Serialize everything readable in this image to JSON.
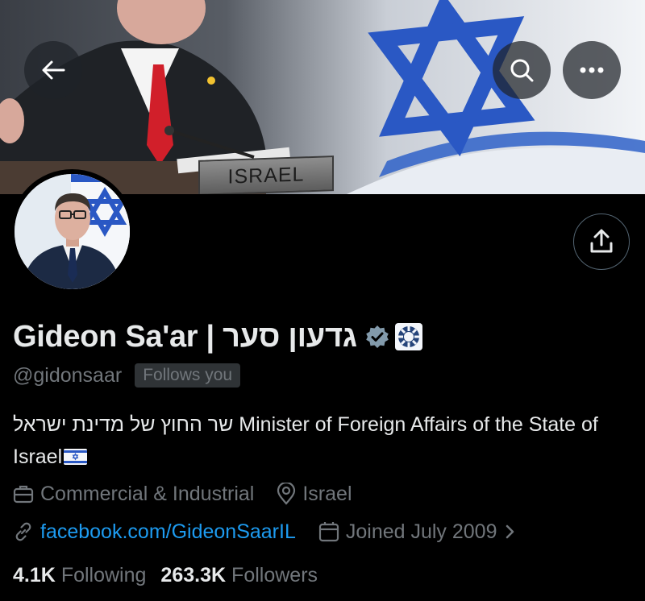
{
  "banner": {
    "nameplate_text": "ISRAEL"
  },
  "header": {
    "back_icon": "arrow-left-icon",
    "search_icon": "search-icon",
    "more_icon": "more-horizontal-icon"
  },
  "profile": {
    "display_name": "Gideon Sa'ar | גדעון סער",
    "handle": "@gidonsaar",
    "follows_you": "Follows you",
    "bio": "שר החוץ של מדינת ישראל Minister of Foreign Affairs of the State of Israel",
    "meta": {
      "category": "Commercial & Industrial",
      "location": "Israel",
      "website": "facebook.com/GideonSaarIL",
      "joined": "Joined July 2009"
    },
    "stats": {
      "following_count": "4.1K",
      "following_label": "Following",
      "followers_count": "263.3K",
      "followers_label": "Followers"
    }
  },
  "colors": {
    "background": "#000000",
    "text_primary": "#e7e9ea",
    "text_secondary": "#71767b",
    "link": "#1d9bf0",
    "verified_badge": "#829aab",
    "flag_blue": "#2a58c4"
  }
}
